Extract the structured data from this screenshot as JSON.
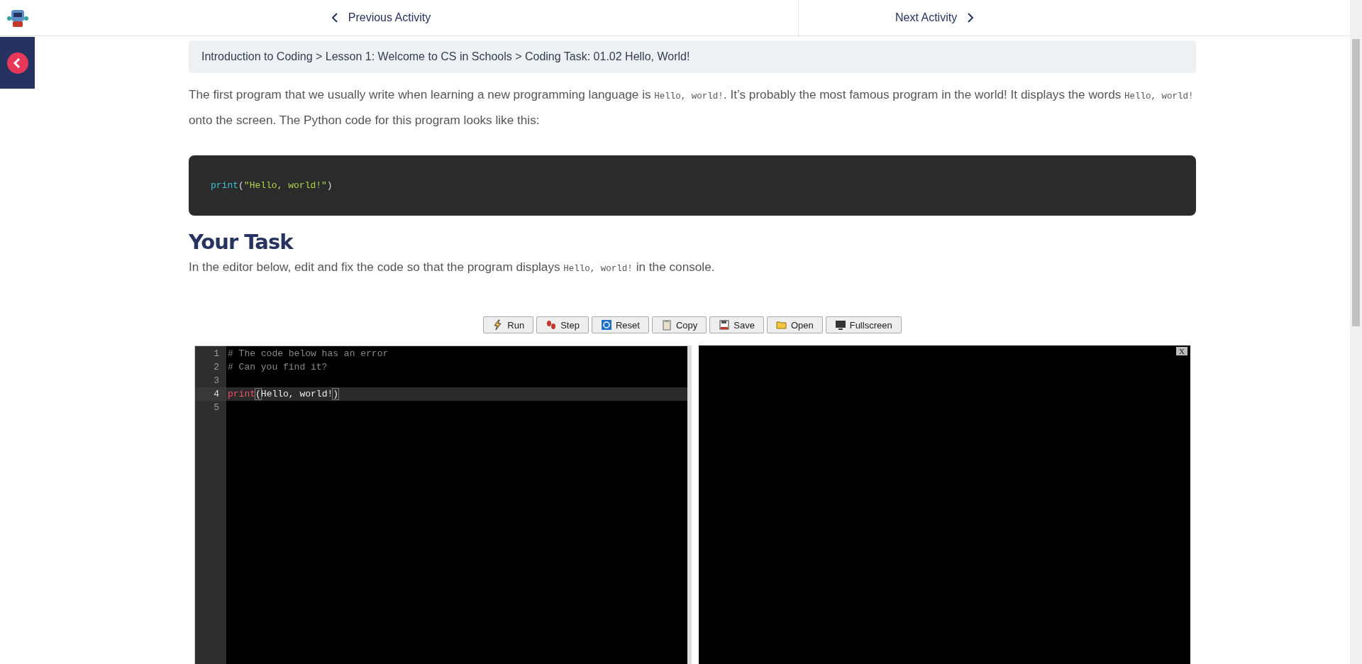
{
  "nav": {
    "previous": "Previous Activity",
    "next": "Next Activity"
  },
  "breadcrumb": "Introduction to Coding > Lesson 1: Welcome to CS in Schools > Coding Task: 01.02 Hello, World!",
  "intro": [
    {
      "kind": "text",
      "text": "The first program that we usually write when learning a new programming language is "
    },
    {
      "kind": "code",
      "text": "Hello, world!"
    },
    {
      "kind": "text",
      "text": ". It’s probably the most famous program in the world! It displays the words "
    },
    {
      "kind": "code",
      "text": "Hello, world!"
    },
    {
      "kind": "text",
      "text": " onto the screen. The Python code for this program looks like this:"
    }
  ],
  "code_sample": [
    {
      "kind": "function",
      "text": "print"
    },
    {
      "kind": "punct",
      "text": "("
    },
    {
      "kind": "string",
      "text": "\"Hello, world!\""
    },
    {
      "kind": "punct",
      "text": ")"
    }
  ],
  "task_heading": "Your Task",
  "task": [
    {
      "kind": "text",
      "text": "In the editor below, edit and fix the code so that the program displays "
    },
    {
      "kind": "code",
      "text": "Hello, world!"
    },
    {
      "kind": "text",
      "text": " in the console."
    }
  ],
  "toolbar": [
    {
      "kind": "run",
      "label": "Run"
    },
    {
      "kind": "step",
      "label": "Step"
    },
    {
      "kind": "reset",
      "label": "Reset"
    },
    {
      "kind": "copy",
      "label": "Copy"
    },
    {
      "kind": "save",
      "label": "Save"
    },
    {
      "kind": "open",
      "label": "Open"
    },
    {
      "kind": "fullscreen",
      "label": "Fullscreen"
    }
  ],
  "editor": {
    "lines": [
      {
        "number": "1",
        "active": false,
        "tokens": [
          {
            "kind": "comment",
            "text": "# The code below has an error"
          }
        ]
      },
      {
        "number": "2",
        "active": false,
        "tokens": [
          {
            "kind": "comment",
            "text": "# Can you find it?"
          }
        ]
      },
      {
        "number": "3",
        "active": false
      },
      {
        "number": "4",
        "active": true,
        "tokens": [
          {
            "kind": "keyword",
            "text": "print"
          },
          {
            "kind": "bracket",
            "text": "("
          },
          {
            "kind": "plain",
            "text": "Hello, world!"
          },
          {
            "kind": "bracket",
            "text": ")"
          }
        ]
      },
      {
        "number": "5",
        "active": false
      }
    ]
  },
  "console": {
    "close": "X"
  }
}
